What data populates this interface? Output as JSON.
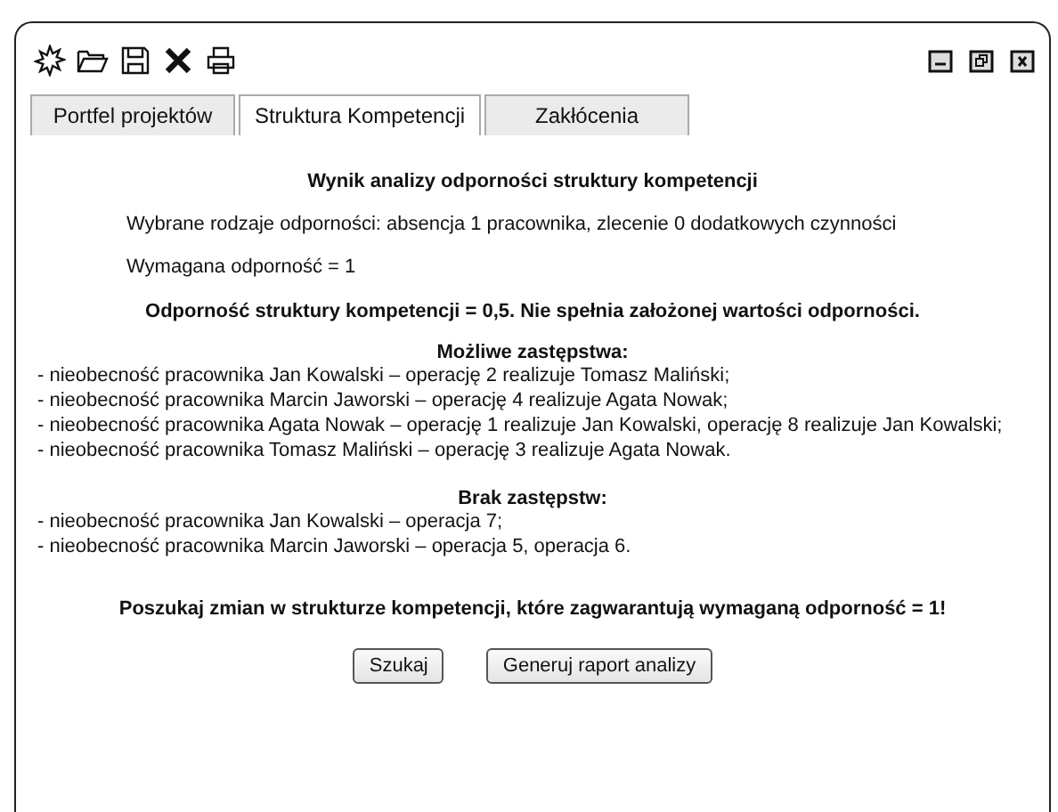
{
  "tabs": [
    {
      "label": "Portfel projektów",
      "selected": false
    },
    {
      "label": "Struktura Kompetencji",
      "selected": true
    },
    {
      "label": "Zakłócenia",
      "selected": false
    }
  ],
  "report": {
    "title": "Wynik analizy odporności struktury kompetencji",
    "selected_types": "Wybrane rodzaje odporności: absencja 1 pracownika, zlecenie 0 dodatkowych czynności",
    "required": "Wymagana odporność = 1",
    "result": "Odporność struktury kompetencji = 0,5. Nie spełnia założonej wartości odporności.",
    "substitutions_heading": "Możliwe zastępstwa:",
    "substitutions": [
      "- nieobecność pracownika Jan Kowalski – operację 2 realizuje Tomasz Maliński;",
      "- nieobecność pracownika Marcin Jaworski – operację 4 realizuje Agata Nowak;",
      "- nieobecność pracownika Agata Nowak – operację 1 realizuje Jan Kowalski, operację 8 realizuje Jan Kowalski;",
      "- nieobecność pracownika Tomasz Maliński – operację 3 realizuje Agata Nowak."
    ],
    "missing_heading": "Brak zastępstw:",
    "missing": [
      "- nieobecność pracownika Jan Kowalski – operacja 7;",
      "- nieobecność pracownika Marcin Jaworski – operacja 5, operacja 6."
    ],
    "prompt": "Poszukaj zmian w strukturze kompetencji, które zagwarantują wymaganą odporność = 1!"
  },
  "buttons": [
    "Szukaj",
    "Generuj raport analizy"
  ]
}
